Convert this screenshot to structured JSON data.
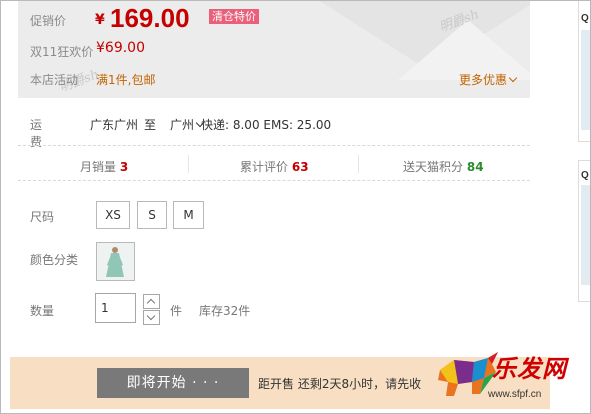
{
  "price": {
    "promo_label": "促销价",
    "currency": "¥",
    "promo_price": "169.00",
    "clearance_badge": "清仓特价",
    "double11_label": "双11狂欢价",
    "double11_price": "¥69.00",
    "store_activity_label": "本店活动",
    "store_activity_text": "满1件,包邮",
    "more_promos": "更多优惠",
    "watermark": "明爵sh"
  },
  "shipping": {
    "label": "运费",
    "from": "广东广州",
    "to_label": "至",
    "to": "广州",
    "fees": "快递: 8.00 EMS: 25.00"
  },
  "stats": {
    "monthly_sales_label": "月销量",
    "monthly_sales_value": "3",
    "reviews_label": "累计评价",
    "reviews_value": "63",
    "points_label": "送天猫积分",
    "points_value": "84"
  },
  "options": {
    "size_label": "尺码",
    "sizes": [
      "XS",
      "S",
      "M"
    ],
    "color_label": "颜色分类",
    "quantity_label": "数量",
    "quantity_value": "1",
    "unit": "件",
    "stock": "库存32件"
  },
  "action": {
    "start_button": "即将开始 · · ·",
    "countdown": "距开售 还剩2天8小时，请先收"
  },
  "logo": {
    "text": "乐发网",
    "url": "www.sfpf.cn"
  },
  "sidebar": {
    "marker": "Q"
  },
  "colors": {
    "price_red": "#c40000",
    "promo_orange": "#c46300",
    "badge_pink": "#ea5f7a",
    "bar_peach": "#f8dfc3",
    "button_gray": "#797979",
    "points_green": "#2c8c2c"
  }
}
